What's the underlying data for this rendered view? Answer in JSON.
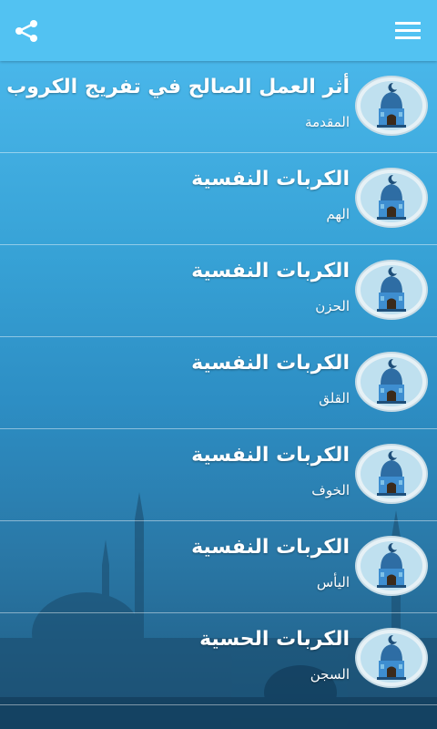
{
  "header": {
    "share_icon": "share-icon",
    "menu_icon": "hamburger-menu-icon",
    "bar_color": "#52c2f2"
  },
  "items": [
    {
      "title": "أثر العمل الصالح في تفريج الكروب",
      "subtitle": "المقدمة",
      "icon": "mosque-icon"
    },
    {
      "title": "الكربات النفسية",
      "subtitle": "الهم",
      "icon": "mosque-icon"
    },
    {
      "title": "الكربات النفسية",
      "subtitle": "الحزن",
      "icon": "mosque-icon"
    },
    {
      "title": "الكربات النفسية",
      "subtitle": "القلق",
      "icon": "mosque-icon"
    },
    {
      "title": "الكربات النفسية",
      "subtitle": "الخوف",
      "icon": "mosque-icon"
    },
    {
      "title": "الكربات النفسية",
      "subtitle": "اليأس",
      "icon": "mosque-icon"
    },
    {
      "title": "الكربات الحسية",
      "subtitle": "السجن",
      "icon": "mosque-icon"
    }
  ]
}
